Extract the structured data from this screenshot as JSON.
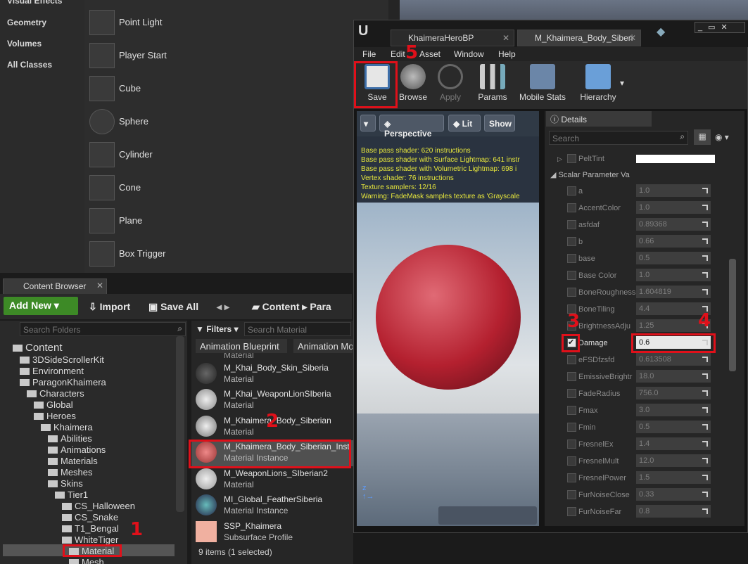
{
  "placement": {
    "categories": [
      "Visual Effects",
      "Geometry",
      "Volumes",
      "All Classes"
    ],
    "items": [
      {
        "label": "Point Light",
        "icon": "point-light-icon"
      },
      {
        "label": "Player Start",
        "icon": "player-start-icon"
      },
      {
        "label": "Cube",
        "icon": "cube-icon"
      },
      {
        "label": "Sphere",
        "icon": "sphere-icon"
      },
      {
        "label": "Cylinder",
        "icon": "cylinder-icon"
      },
      {
        "label": "Cone",
        "icon": "cone-icon"
      },
      {
        "label": "Plane",
        "icon": "plane-icon"
      },
      {
        "label": "Box Trigger",
        "icon": "box-trigger-icon"
      }
    ]
  },
  "content_browser": {
    "tab": "Content Browser",
    "add_new": "Add New",
    "import": "Import",
    "save_all": "Save All",
    "path_root": "Content",
    "path_next": "Para",
    "search_folders": "Search Folders",
    "filters": "Filters",
    "search_material": "Search Material",
    "filter_chips": [
      "Animation Blueprint",
      "Animation Mo"
    ],
    "tree": [
      "Content",
      "3DSideScrollerKit",
      "Environment",
      "ParagonKhaimera",
      "Characters",
      "Global",
      "Heroes",
      "Khaimera",
      "Abilities",
      "Animations",
      "Materials",
      "Meshes",
      "Skins",
      "Tier1",
      "CS_Halloween",
      "CS_Snake",
      "T1_Bengal",
      "WhiteTiger",
      "Material",
      "Mesh"
    ],
    "assets": [
      {
        "name": "M_Khai_Body_Skin_Siberia",
        "type": "Material"
      },
      {
        "name": "M_Khai_WeaponLionSIberia",
        "type": "Material"
      },
      {
        "name": "M_Khaimera_Body_Siberian",
        "type": "Material"
      },
      {
        "name": "M_Khaimera_Body_Siberian_Inst",
        "type": "Material Instance"
      },
      {
        "name": "M_WeaponLions_SIberian2",
        "type": "Material"
      },
      {
        "name": "MI_Global_FeatherSiberia",
        "type": "Material Instance"
      },
      {
        "name": "SSP_Khaimera",
        "type": "Subsurface Profile"
      }
    ],
    "partial_top_label": "Material",
    "status": "9 items (1 selected)"
  },
  "editor": {
    "tabs": [
      "KhaimeraHeroBP",
      "M_Khaimera_Body_Siberi"
    ],
    "menu": [
      "File",
      "Edit",
      "Asset",
      "Window",
      "Help"
    ],
    "tools": [
      "Save",
      "Browse",
      "Apply",
      "Params",
      "Mobile Stats",
      "Hierarchy"
    ],
    "viewport": {
      "buttons": [
        "Perspective",
        "Lit",
        "Show"
      ],
      "stats": [
        "Base pass shader: 620 instructions",
        "Base pass shader with Surface Lightmap: 641 instr",
        "Base pass shader with Volumetric Lightmap: 698 i",
        "Vertex shader: 76 instructions",
        "Texture samplers: 12/16",
        "Warning: FadeMask samples texture as 'Grayscale"
      ]
    },
    "details": {
      "tab": "Details",
      "search": "Search",
      "pelt": "PeltTint",
      "section": "Scalar Parameter Va",
      "params": [
        {
          "name": "a",
          "value": "1.0"
        },
        {
          "name": "AccentColor",
          "value": "1.0"
        },
        {
          "name": "asfdaf",
          "value": "0.89368"
        },
        {
          "name": "b",
          "value": "0.66"
        },
        {
          "name": "base",
          "value": "0.5"
        },
        {
          "name": "Base Color",
          "value": "1.0"
        },
        {
          "name": "BoneRoughness",
          "value": "1.604819"
        },
        {
          "name": "BoneTiling",
          "value": "4.4"
        },
        {
          "name": "BrightnessAdju",
          "value": "1.25"
        },
        {
          "name": "Damage",
          "value": "0.6"
        },
        {
          "name": "eFSDfzsfd",
          "value": "0.613508"
        },
        {
          "name": "EmissiveBrightr",
          "value": "18.0"
        },
        {
          "name": "FadeRadius",
          "value": "756.0"
        },
        {
          "name": "Fmax",
          "value": "3.0"
        },
        {
          "name": "Fmin",
          "value": "0.5"
        },
        {
          "name": "FresnelEx",
          "value": "1.4"
        },
        {
          "name": "FresnelMult",
          "value": "12.0"
        },
        {
          "name": "FresnelPower",
          "value": "1.5"
        },
        {
          "name": "FurNoiseClose",
          "value": "0.33"
        },
        {
          "name": "FurNoiseFar",
          "value": "0.8"
        }
      ]
    }
  },
  "annotations": [
    "1",
    "2",
    "3",
    "4",
    "5"
  ]
}
